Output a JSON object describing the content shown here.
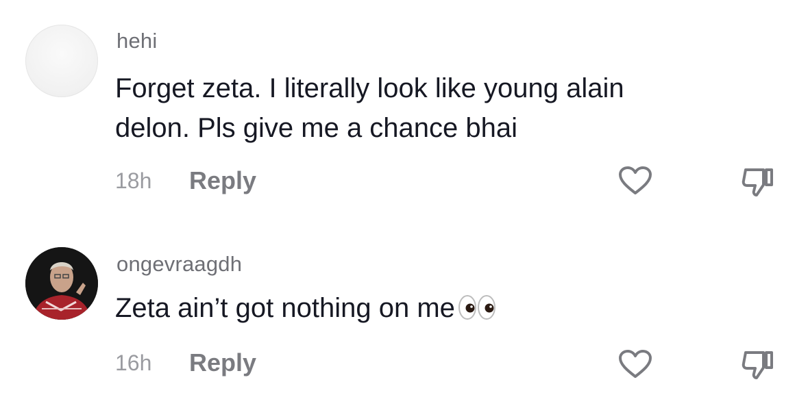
{
  "comments": [
    {
      "username": "hehi",
      "text_lines": [
        "Forget zeta. I literally look like young alain",
        "delon. Pls give me a chance bhai"
      ],
      "time": "18h",
      "reply_label": "Reply"
    },
    {
      "username": "ongevraagdh",
      "text_lines": [
        "Zeta ain’t got nothing on me"
      ],
      "emoji": "eyes-emoji",
      "time": "16h",
      "reply_label": "Reply"
    }
  ],
  "icons": {
    "like": "heart-icon",
    "dislike": "thumbs-down-icon"
  },
  "colors": {
    "text": "#161823",
    "username": "#6e6f75",
    "meta": "#9a9ba0",
    "icon": "#7a7b80"
  }
}
